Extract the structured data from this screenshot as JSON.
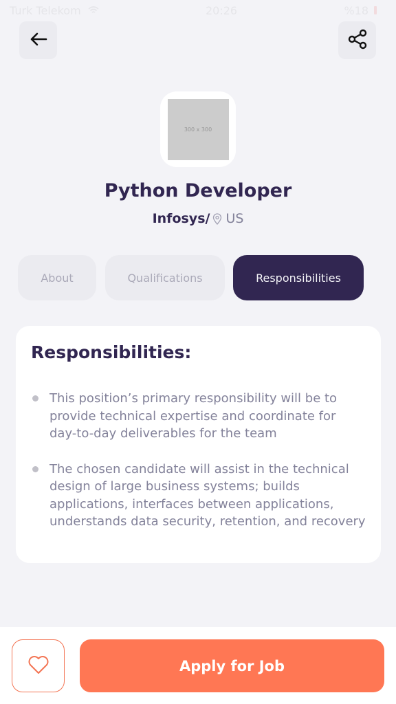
{
  "status_bar": {
    "carrier": "Turk Telekom",
    "time": "20:26",
    "battery": "%18"
  },
  "header": {
    "back_icon": "arrow-left-icon",
    "share_icon": "share-icon"
  },
  "company": {
    "logo_placeholder": "300 x 300",
    "name": "Infosys/",
    "location": "US",
    "location_icon": "map-pin-icon"
  },
  "job": {
    "title": "Python Developer"
  },
  "tabs": [
    {
      "label": "About",
      "active": false
    },
    {
      "label": "Qualifications",
      "active": false
    },
    {
      "label": "Responsibilities",
      "active": true
    }
  ],
  "responsibilities": {
    "heading": "Responsibilities:",
    "items": [
      "This position’s primary responsibility will be to provide technical expertise and coordinate for day-to-day deliverables for the team",
      "The chosen candidate will assist in the technical design of large business systems; builds applications, interfaces between applications, understands data security, retention, and recovery"
    ]
  },
  "footer": {
    "like_icon": "heart-icon",
    "apply_label": "Apply for Job"
  },
  "colors": {
    "primary": "#312651",
    "accent": "#FF7754",
    "background": "#F3F3F7",
    "gray": "#83829A"
  }
}
